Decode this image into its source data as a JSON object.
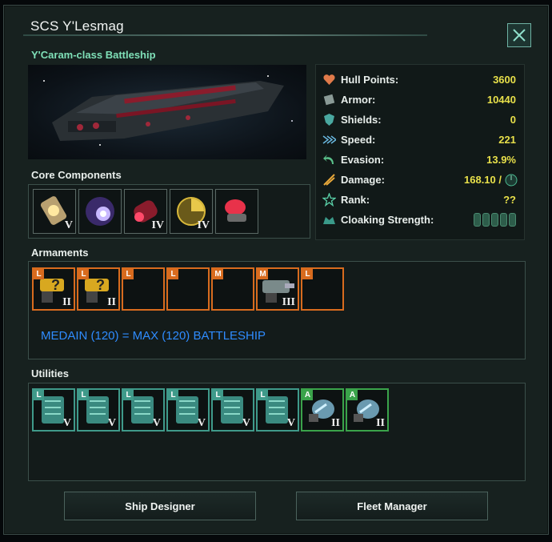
{
  "window": {
    "title": "SCS Y'Lesmag",
    "subtitle": "Y'Caram-class Battleship",
    "close_icon": "close-icon"
  },
  "core": {
    "label": "Core Components",
    "slots": [
      {
        "icon": "reactor-icon",
        "tier": "V"
      },
      {
        "icon": "ftl-drive-icon",
        "tier": ""
      },
      {
        "icon": "thruster-icon",
        "tier": "IV"
      },
      {
        "icon": "sensor-icon",
        "tier": "IV"
      },
      {
        "icon": "combat-computer-icon",
        "tier": ""
      }
    ]
  },
  "stats": [
    {
      "label": "Hull Points:",
      "value": "3600",
      "icon": "hull-icon"
    },
    {
      "label": "Armor:",
      "value": "10440",
      "icon": "armor-icon"
    },
    {
      "label": "Shields:",
      "value": "0",
      "icon": "shield-icon"
    },
    {
      "label": "Speed:",
      "value": "221",
      "icon": "speed-icon"
    },
    {
      "label": "Evasion:",
      "value": "13.9%",
      "icon": "evasion-icon"
    },
    {
      "label": "Damage:",
      "value": "168.10 /",
      "icon": "damage-icon"
    },
    {
      "label": "Rank:",
      "value": "??",
      "icon": "rank-icon"
    },
    {
      "label": "Cloaking Strength:",
      "value": "",
      "icon": "cloaking-icon"
    }
  ],
  "armament": {
    "label": "Armaments",
    "note": "MEDAIN (120) = MAX (120) BATTLESHIP",
    "slots": [
      {
        "tag": "L",
        "tier": "II",
        "filled": true
      },
      {
        "tag": "L",
        "tier": "II",
        "filled": true
      },
      {
        "tag": "L",
        "tier": "",
        "filled": false
      },
      {
        "tag": "L",
        "tier": "",
        "filled": false
      },
      {
        "tag": "M",
        "tier": "",
        "filled": false
      },
      {
        "tag": "M",
        "tier": "III",
        "filled": true
      },
      {
        "tag": "L",
        "tier": "",
        "filled": false
      }
    ]
  },
  "utilities": {
    "label": "Utilities",
    "slots": [
      {
        "tag": "L",
        "tier": "V"
      },
      {
        "tag": "L",
        "tier": "V"
      },
      {
        "tag": "L",
        "tier": "V"
      },
      {
        "tag": "L",
        "tier": "V"
      },
      {
        "tag": "L",
        "tier": "V"
      },
      {
        "tag": "L",
        "tier": "V"
      },
      {
        "tag": "A",
        "tier": "II"
      },
      {
        "tag": "A",
        "tier": "II"
      }
    ]
  },
  "buttons": {
    "ship_designer": "Ship Designer",
    "fleet_manager": "Fleet Manager"
  },
  "colors": {
    "accent": "#7fe0b8",
    "value": "#e8e04a",
    "weapon_slot": "#d86b1e",
    "utility_slot": "#3f9a8a",
    "aux_slot": "#3aa34a",
    "note": "#2f8cff"
  }
}
